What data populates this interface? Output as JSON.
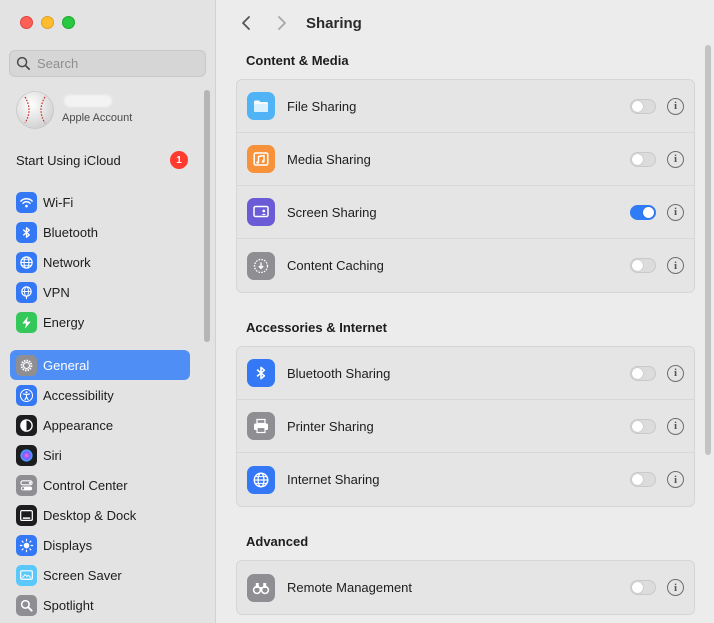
{
  "sidebar": {
    "search_placeholder": "Search",
    "account": {
      "subtitle": "Apple Account"
    },
    "icloud": {
      "label": "Start Using iCloud",
      "badge": "1"
    },
    "group1": [
      {
        "name": "wifi",
        "label": "Wi-Fi",
        "color": "#3478f6",
        "icon": "wifi-icon"
      },
      {
        "name": "bluetooth",
        "label": "Bluetooth",
        "color": "#3478f6",
        "icon": "bluetooth-icon"
      },
      {
        "name": "network",
        "label": "Network",
        "color": "#3478f6",
        "icon": "globe-icon"
      },
      {
        "name": "vpn",
        "label": "VPN",
        "color": "#3478f6",
        "icon": "vpn-globe-icon"
      },
      {
        "name": "energy",
        "label": "Energy",
        "color": "#34c759",
        "icon": "bolt-icon"
      }
    ],
    "group2": [
      {
        "name": "general",
        "label": "General",
        "color": "#8e8e93",
        "icon": "gear-icon"
      },
      {
        "name": "accessibility",
        "label": "Accessibility",
        "color": "#3478f6",
        "icon": "accessibility-icon"
      },
      {
        "name": "appearance",
        "label": "Appearance",
        "color": "#1d1d1f",
        "icon": "appearance-icon"
      },
      {
        "name": "siri",
        "label": "Siri",
        "color": "#1d1d1f",
        "icon": "siri-icon"
      },
      {
        "name": "control-center",
        "label": "Control Center",
        "color": "#8e8e93",
        "icon": "switches-icon"
      },
      {
        "name": "desktop-dock",
        "label": "Desktop & Dock",
        "color": "#1d1d1f",
        "icon": "dock-icon"
      },
      {
        "name": "displays",
        "label": "Displays",
        "color": "#3478f6",
        "icon": "sun-icon"
      },
      {
        "name": "screen-saver",
        "label": "Screen Saver",
        "color": "#5ac8fa",
        "icon": "screen-saver-icon"
      },
      {
        "name": "spotlight",
        "label": "Spotlight",
        "color": "#8e8e93",
        "icon": "magnifier-icon"
      }
    ]
  },
  "toolbar": {
    "title": "Sharing"
  },
  "sections": [
    {
      "title": "Content & Media",
      "rows": [
        {
          "name": "file-sharing",
          "label": "File Sharing",
          "on": false,
          "icon": "folder-icon",
          "color": "#4fb3f6"
        },
        {
          "name": "media-sharing",
          "label": "Media Sharing",
          "on": false,
          "icon": "media-icon",
          "color": "#f7913a"
        },
        {
          "name": "screen-sharing",
          "label": "Screen Sharing",
          "on": true,
          "icon": "screen-share-icon",
          "color": "#6b5bd6"
        },
        {
          "name": "content-caching",
          "label": "Content Caching",
          "on": false,
          "icon": "download-circle-icon",
          "color": "#8e8e93"
        }
      ]
    },
    {
      "title": "Accessories & Internet",
      "rows": [
        {
          "name": "bluetooth-sharing",
          "label": "Bluetooth Sharing",
          "on": false,
          "icon": "bluetooth-icon",
          "color": "#3478f6"
        },
        {
          "name": "printer-sharing",
          "label": "Printer Sharing",
          "on": false,
          "icon": "printer-icon",
          "color": "#8e8e93"
        },
        {
          "name": "internet-sharing",
          "label": "Internet Sharing",
          "on": false,
          "icon": "globe-icon",
          "color": "#3478f6"
        }
      ]
    },
    {
      "title": "Advanced",
      "rows": [
        {
          "name": "remote-management",
          "label": "Remote Management",
          "on": false,
          "icon": "binoculars-icon",
          "color": "#8e8e93"
        }
      ]
    }
  ],
  "info_glyph": "i"
}
